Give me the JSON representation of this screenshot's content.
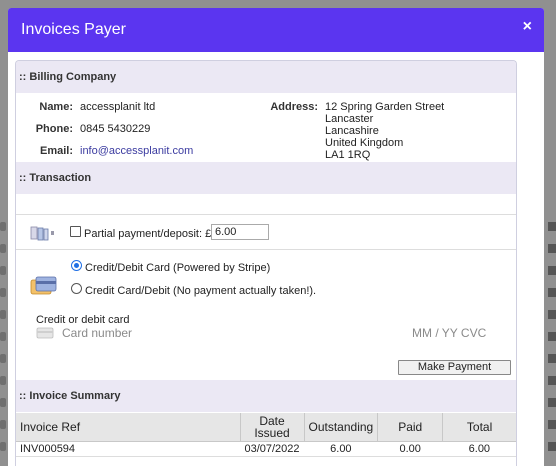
{
  "modal": {
    "title": "Invoices Payer",
    "close_label": "×"
  },
  "billing": {
    "header": ":: Billing Company",
    "name_label": "Name:",
    "name_value": "accessplanit ltd",
    "phone_label": "Phone:",
    "phone_value": "0845 5430229",
    "email_label": "Email:",
    "email_value": "info@accessplanit.com",
    "address_label": "Address:",
    "address_lines": [
      "12 Spring Garden Street",
      "Lancaster",
      "Lancashire",
      "United Kingdom",
      "LA1 1RQ"
    ]
  },
  "transaction": {
    "header": ":: Transaction",
    "partial_label": "Partial payment/deposit: £",
    "partial_value": "6.00",
    "option_stripe": "Credit/Debit Card (Powered by Stripe)",
    "option_no_payment": "Credit Card/Debit (No payment actually taken!).",
    "card_label": "Credit or debit card",
    "card_number_placeholder": "Card number",
    "card_expiry_cvc_placeholder": "MM / YY  CVC",
    "make_payment_label": "Make Payment"
  },
  "summary": {
    "header": ":: Invoice Summary",
    "columns": [
      "Invoice Ref",
      "Date Issued",
      "Outstanding",
      "Paid",
      "Total"
    ],
    "rows": [
      {
        "ref": "INV000594",
        "date": "03/07/2022",
        "outstanding": "6.00",
        "paid": "0.00",
        "total": "6.00"
      }
    ]
  },
  "icons": [
    "close-icon",
    "cards-icon",
    "credit-card-icon",
    "card-number-icon"
  ],
  "colors": {
    "header": "#5b35f0",
    "section": "#ebe8f4",
    "link": "#3b3ba0"
  }
}
